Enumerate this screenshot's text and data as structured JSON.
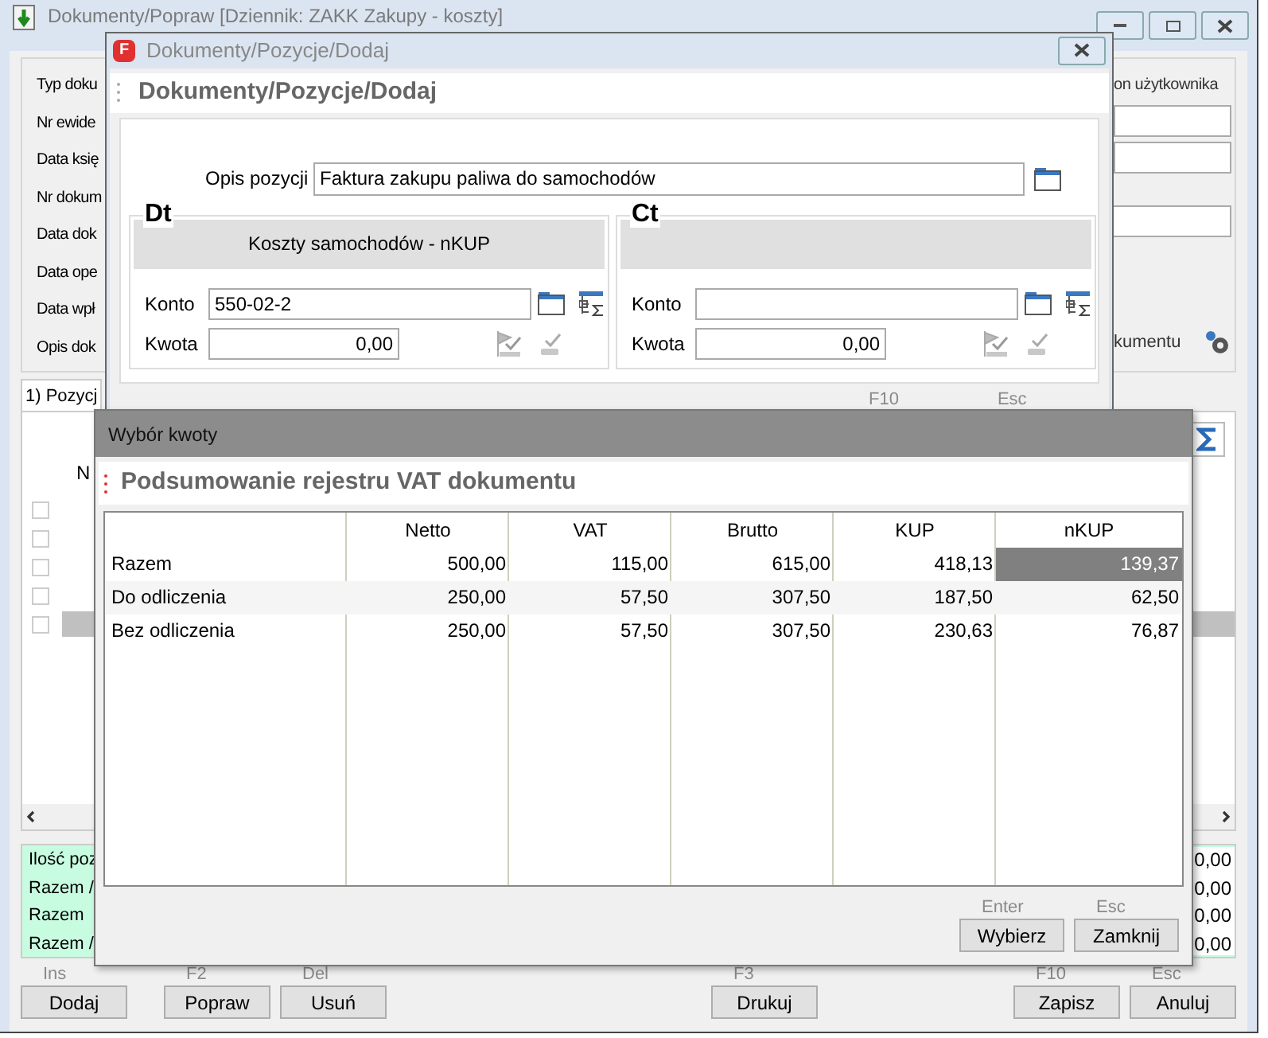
{
  "main_window": {
    "title": "Dokumenty/Popraw [Dziennik: ZAKK  Zakupy - koszty]",
    "field_labels": [
      "Typ doku",
      "Nr ewide",
      "Data księ",
      "Nr dokum",
      "Data dok",
      "Data ope",
      "Data wpł",
      "Opis dok"
    ],
    "right_label": "on użytkownika",
    "description_suffix": "kumentu",
    "tab": {
      "label": "1) Pozycj",
      "selected": true
    },
    "grid": {
      "column_1": "N",
      "rows": [
        {
          "checked": false,
          "selected": false
        },
        {
          "checked": false,
          "selected": false
        },
        {
          "checked": false,
          "selected": false
        },
        {
          "checked": false,
          "selected": false
        },
        {
          "checked": false,
          "selected": true
        }
      ]
    },
    "summary_labels": [
      "Ilość poz",
      "Razem /",
      "Razem",
      "Razem /"
    ],
    "summary_values": [
      "0,00",
      "0,00",
      "0,00",
      "0,00"
    ],
    "buttons_left": [
      {
        "shortcut": "Ins",
        "label": "Dodaj"
      },
      {
        "shortcut": "F2",
        "label": "Popraw"
      },
      {
        "shortcut": "Del",
        "label": "Usuń"
      }
    ],
    "print_button": {
      "shortcut": "F3",
      "label": "Drukuj"
    },
    "buttons_right": [
      {
        "shortcut": "F10",
        "label": "Zapisz"
      },
      {
        "shortcut": "Esc",
        "label": "Anuluj"
      }
    ]
  },
  "position_dialog": {
    "logo_letter": "F",
    "title": "Dokumenty/Pozycje/Dodaj",
    "header": "Dokumenty/Pozycje/Dodaj",
    "description_label": "Opis pozycji",
    "description_value": "Faktura zakupu paliwa do samochodów",
    "sides": [
      {
        "heading": "Dt",
        "account_name": "Koszty samochodów - nKUP",
        "account_label": "Konto",
        "account_value": "550-02-2",
        "amount_label": "Kwota",
        "amount_value": "0,00"
      },
      {
        "heading": "Ct",
        "account_label": "Konto",
        "amount_label": "Kwota",
        "amount_value": "0,00"
      }
    ],
    "shortcuts": [
      "F10",
      "Esc"
    ]
  },
  "amount_dialog": {
    "title": "Wybór kwoty",
    "header": "Podsumowanie rejestru VAT dokumentu",
    "table": {
      "columns": [
        "Netto",
        "VAT",
        "Brutto",
        "KUP",
        "nKUP"
      ],
      "rows": [
        {
          "label": "Razem",
          "cells": [
            {
              "text": "500,00",
              "selected": false
            },
            {
              "text": "115,00",
              "selected": false
            },
            {
              "text": "615,00",
              "selected": false
            },
            {
              "text": "418,13",
              "selected": false
            },
            {
              "text": "139,37",
              "selected": true
            }
          ]
        },
        {
          "label": "Do odliczenia",
          "cells": [
            {
              "text": "250,00",
              "selected": false
            },
            {
              "text": "57,50",
              "selected": false
            },
            {
              "text": "307,50",
              "selected": false
            },
            {
              "text": "187,50",
              "selected": false
            },
            {
              "text": "62,50",
              "selected": false
            }
          ]
        },
        {
          "label": "Bez odliczenia",
          "cells": [
            {
              "text": "250,00",
              "selected": false
            },
            {
              "text": "57,50",
              "selected": false
            },
            {
              "text": "307,50",
              "selected": false
            },
            {
              "text": "230,63",
              "selected": false
            },
            {
              "text": "76,87",
              "selected": false
            }
          ]
        }
      ]
    },
    "buttons": [
      {
        "shortcut": "Enter",
        "label": "Wybierz"
      },
      {
        "shortcut": "Esc",
        "label": "Zamknij"
      }
    ]
  }
}
